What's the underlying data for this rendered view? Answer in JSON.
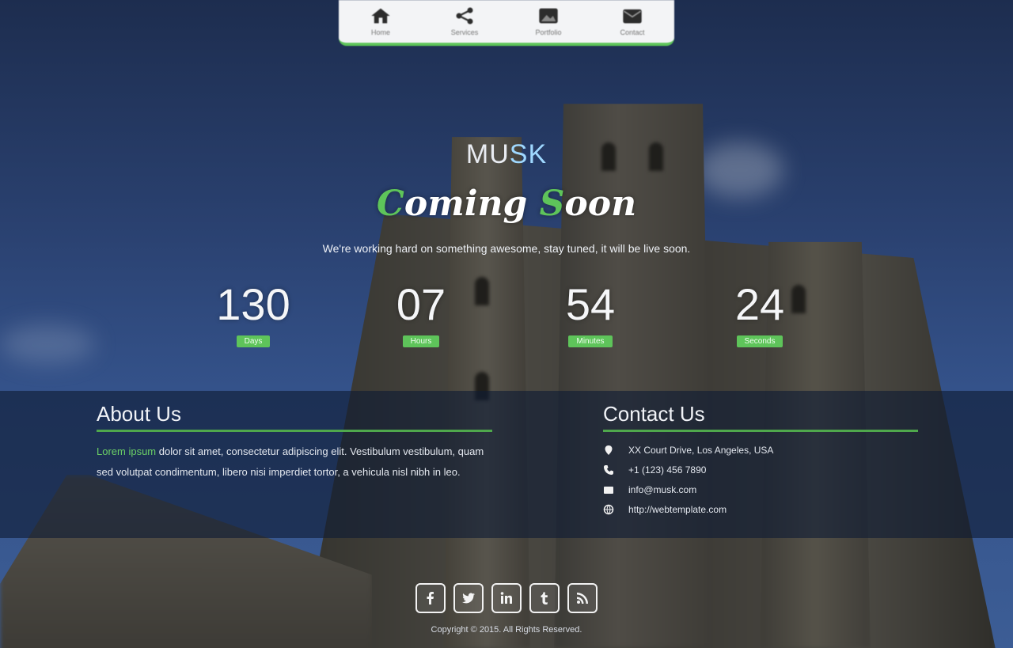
{
  "nav": {
    "items": [
      {
        "label": "Home",
        "icon": "home-icon"
      },
      {
        "label": "Services",
        "icon": "share-icon"
      },
      {
        "label": "Portfolio",
        "icon": "image-icon"
      },
      {
        "label": "Contact",
        "icon": "mail-icon"
      }
    ]
  },
  "hero": {
    "logo_main": "MU",
    "logo_accent": "SK",
    "headline_c": "C",
    "headline_word1": "oming ",
    "headline_s": "S",
    "headline_word2": "oon",
    "tagline": "We're working hard on something awesome, stay tuned, it will be live soon."
  },
  "countdown": [
    {
      "value": "130",
      "label": "Days"
    },
    {
      "value": "07",
      "label": "Hours"
    },
    {
      "value": "54",
      "label": "Minutes"
    },
    {
      "value": "24",
      "label": "Seconds"
    }
  ],
  "about": {
    "title": "About Us",
    "highlight": "Lorem ipsum",
    "text": " dolor sit amet, consectetur adipiscing elit. Vestibulum vestibulum, quam sed volutpat condimentum, libero nisi imperdiet tortor, a vehicula nisl nibh in leo."
  },
  "contact": {
    "title": "Contact Us",
    "items": [
      {
        "icon": "location-icon",
        "text": "XX Court Drive, Los Angeles, USA"
      },
      {
        "icon": "phone-icon",
        "text": "+1 (123) 456 7890"
      },
      {
        "icon": "mail-icon",
        "text": "info@musk.com"
      },
      {
        "icon": "globe-icon",
        "text": "http://webtemplate.com"
      }
    ]
  },
  "social": [
    "facebook-icon",
    "twitter-icon",
    "linkedin-icon",
    "tumblr-icon",
    "rss-icon"
  ],
  "footer": {
    "copyright": "Copyright © 2015. All Rights Reserved."
  },
  "colors": {
    "accent": "#5ec45a",
    "band": "#0f1b34",
    "sky": "#2a4170"
  }
}
